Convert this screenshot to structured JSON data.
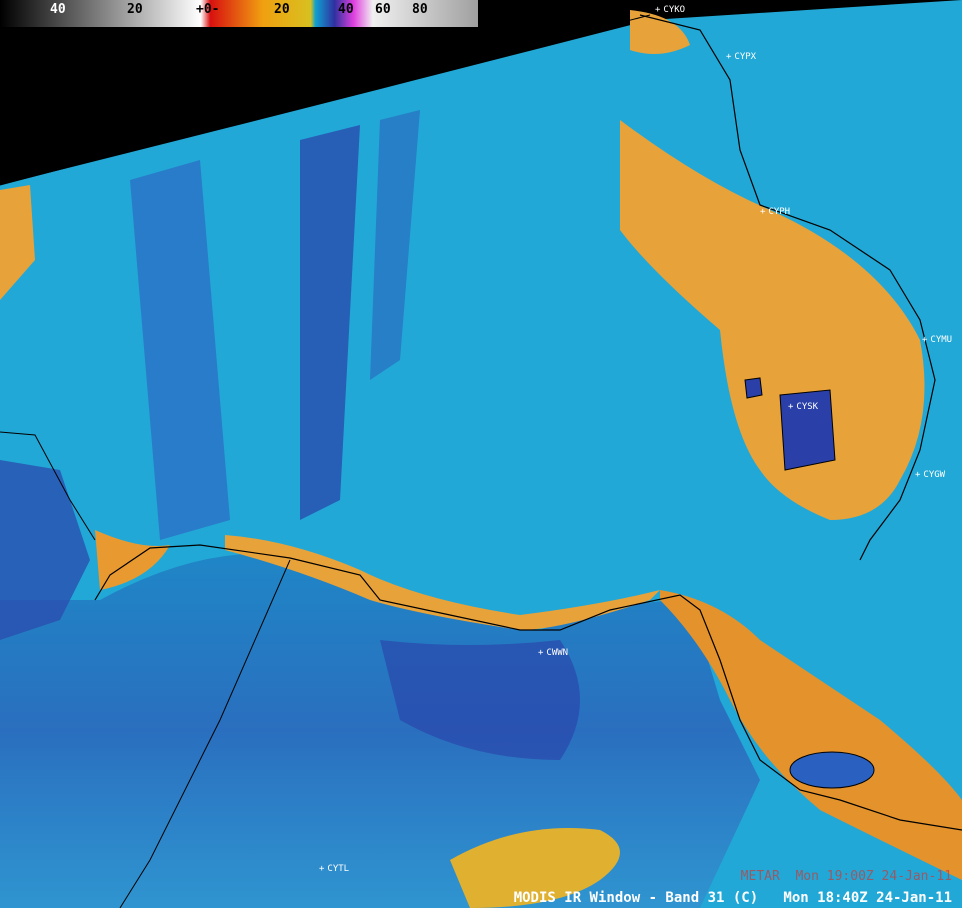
{
  "colorbar": {
    "labels": [
      "40",
      "20",
      "+0-",
      "20",
      "40",
      "60",
      "80"
    ],
    "colors": [
      "#000000",
      "#ffffff",
      "#d81010",
      "#f0a010",
      "#10a0d0",
      "#3030a0",
      "#e040e0",
      "#c0c0c0"
    ]
  },
  "stations": [
    "CYKO",
    "CYPX",
    "CYPH",
    "CYMU",
    "CYSK",
    "CYGW",
    "CWWN",
    "CYTL"
  ],
  "caption": "MODIS IR Window - Band 31 (C)   Mon 18:40Z 24-Jan-11",
  "metar": "METAR  Mon 19:00Z 24-Jan-11",
  "palette": {
    "cold_deep": "#2a3fa8",
    "cold": "#1e88c8",
    "mid": "#22b0d6",
    "warm": "#e8a23a",
    "warm_dark": "#d47a1e",
    "background": "#000000"
  }
}
